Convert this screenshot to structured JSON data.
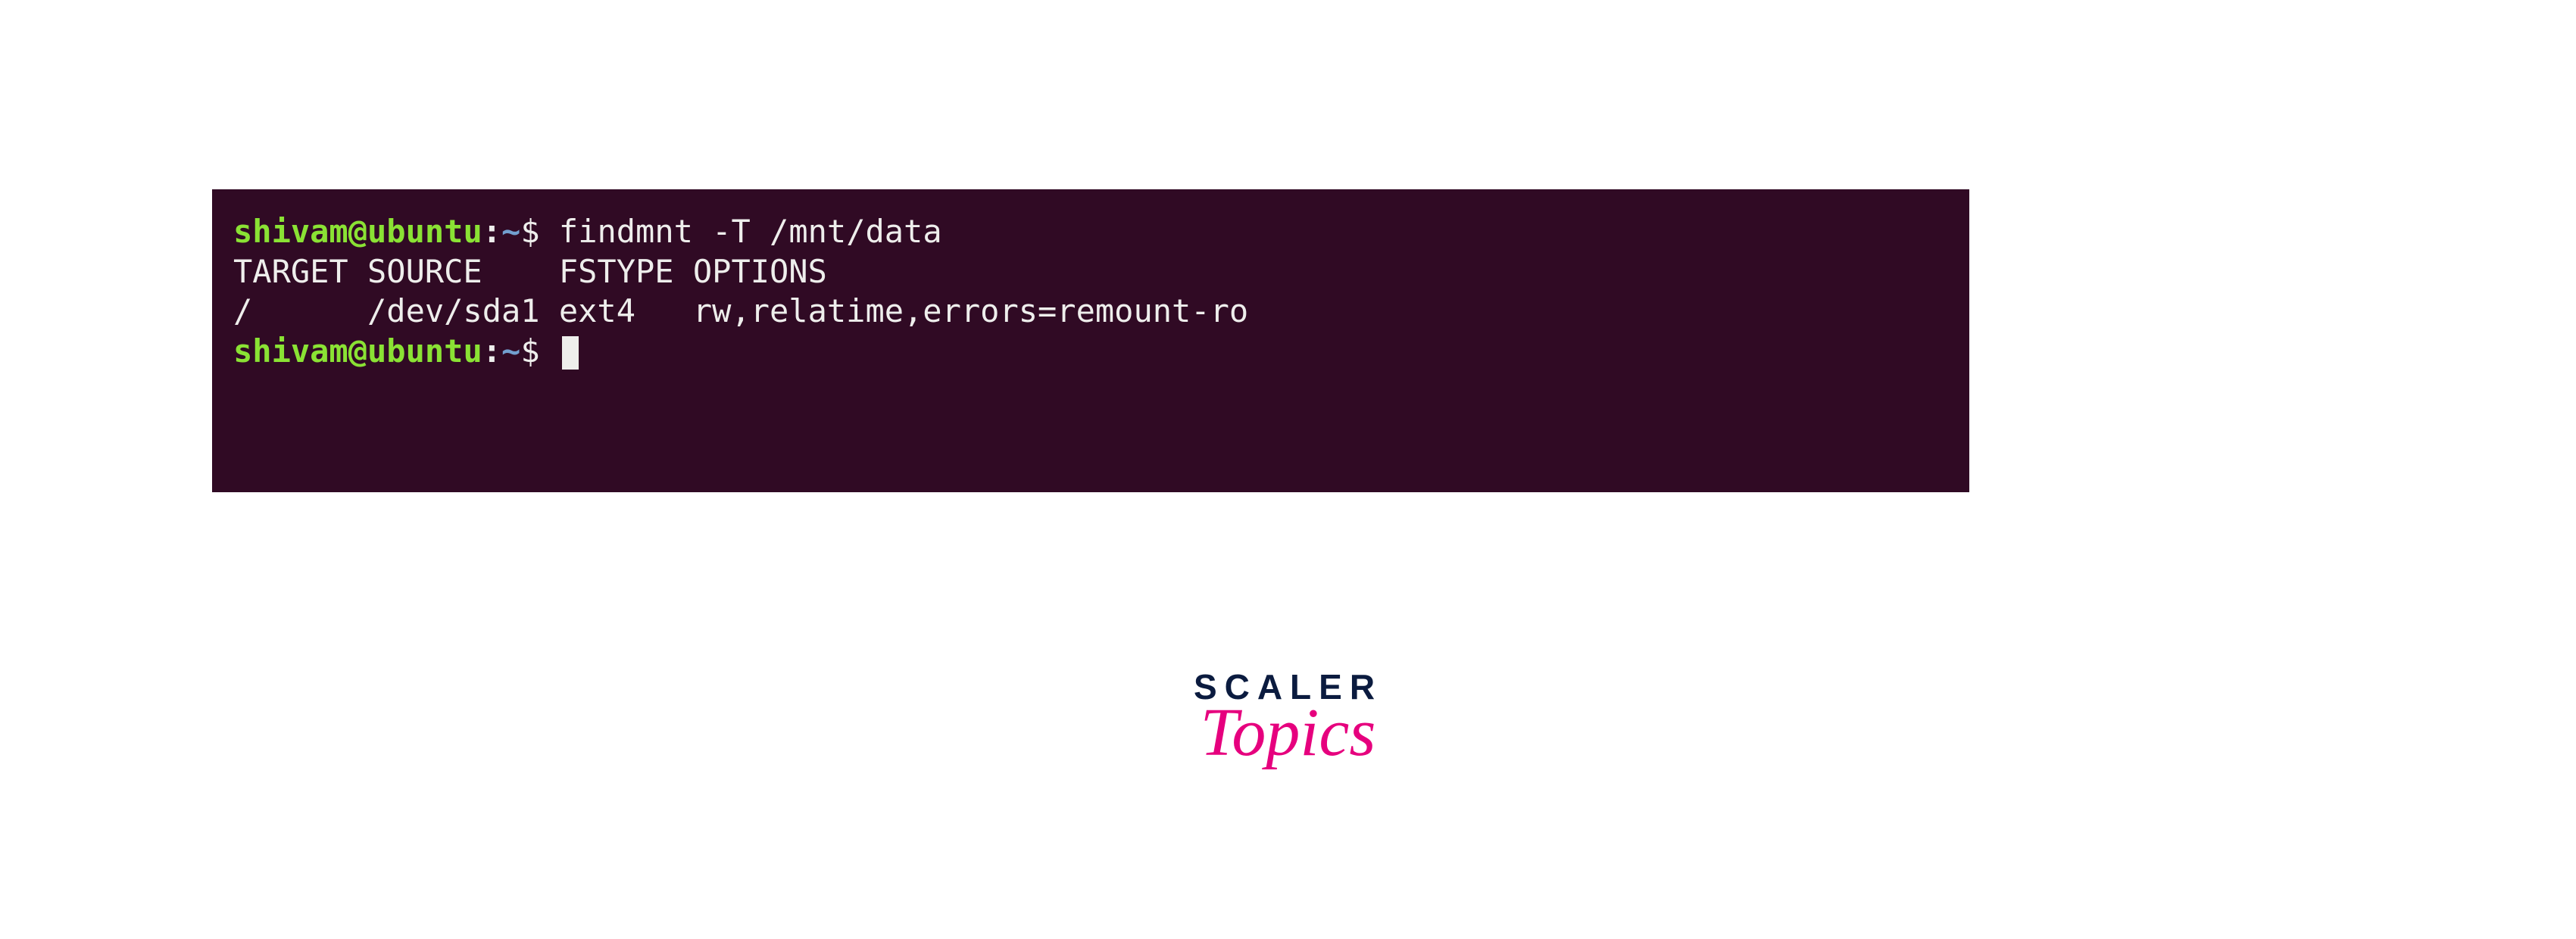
{
  "terminal": {
    "prompt1": {
      "user": "shivam",
      "at": "@",
      "host": "ubuntu",
      "colon": ":",
      "path": "~",
      "dollar": "$ ",
      "command": "findmnt -T /mnt/data"
    },
    "output_header": "TARGET SOURCE    FSTYPE OPTIONS",
    "output_row": "/      /dev/sda1 ext4   rw,relatime,errors=remount-ro",
    "prompt2": {
      "user": "shivam",
      "at": "@",
      "host": "ubuntu",
      "colon": ":",
      "path": "~",
      "dollar": "$ "
    }
  },
  "logo": {
    "line1": "SCALER",
    "line2": "Topics"
  }
}
